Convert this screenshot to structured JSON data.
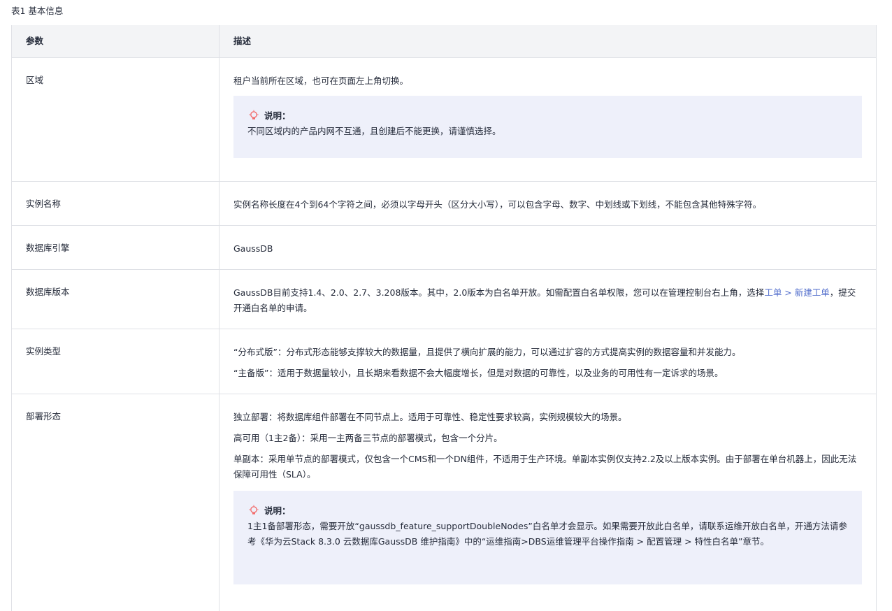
{
  "caption": "表1 基本信息",
  "header": {
    "param": "参数",
    "desc": "描述"
  },
  "rows": {
    "region": {
      "param": "区域",
      "desc": "租户当前所在区域，也可在页面左上角切换。",
      "note_title": "说明：",
      "note_body": "不同区域内的产品内网不互通，且创建后不能更换，请谨慎选择。"
    },
    "instance_name": {
      "param": "实例名称",
      "desc": "实例名称长度在4个到64个字符之间，必须以字母开头（区分大小写），可以包含字母、数字、中划线或下划线，不能包含其他特殊字符。"
    },
    "engine": {
      "param": "数据库引擎",
      "desc": "GaussDB"
    },
    "version": {
      "param": "数据库版本",
      "desc_before": "GaussDB目前支持1.4、2.0、2.7、3.208版本。其中，2.0版本为白名单开放。如需配置白名单权限，您可以在管理控制台右上角，选择",
      "desc_link": "工单 > 新建工单",
      "desc_after": "，提交开通白名单的申请。"
    },
    "instance_type": {
      "param": "实例类型",
      "line1": "“分布式版”：分布式形态能够支撑较大的数据量，且提供了横向扩展的能力，可以通过扩容的方式提高实例的数据容量和并发能力。",
      "line2": "“主备版”：适用于数据量较小，且长期来看数据不会大幅度增长，但是对数据的可靠性，以及业务的可用性有一定诉求的场景。"
    },
    "deployment": {
      "param": "部署形态",
      "line1": "独立部署：将数据库组件部署在不同节点上。适用于可靠性、稳定性要求较高，实例规模较大的场景。",
      "line2": "高可用（1主2备）：采用一主两备三节点的部署模式，包含一个分片。",
      "line3": "单副本：采用单节点的部署模式，仅包含一个CMS和一个DN组件，不适用于生产环境。单副本实例仅支持2.2及以上版本实例。由于部署在单台机器上，因此无法保障可用性（SLA）。",
      "note_title": "说明：",
      "note_body": "1主1备部署形态，需要开放“gaussdb_feature_supportDoubleNodes”白名单才会显示。如果需要开放此白名单，请联系运维开放白名单，开通方法请参考《华为云Stack 8.3.0 云数据库GaussDB 维护指南》中的“运维指南>DBS运维管理平台操作指南 > 配置管理 > 特性白名单”章节。"
    }
  },
  "icons": {
    "note": "lightbulb-icon"
  },
  "colors": {
    "link": "#526ecc",
    "note_bg": "#eef0fa",
    "header_bg": "#f3f4f6",
    "bulb": "#f26d6d"
  }
}
